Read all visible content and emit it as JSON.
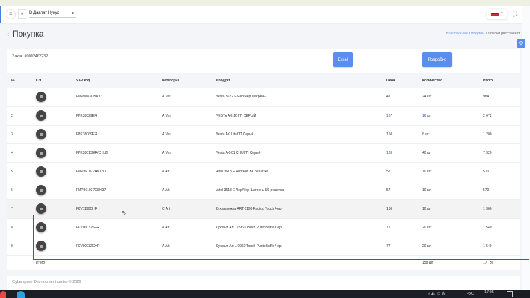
{
  "header": {
    "branch": "D Давлат Нукус"
  },
  "page": {
    "title": "Покупка",
    "breadcrumbs": [
      "приложение",
      "покупки",
      "sidebar.purchaseid"
    ]
  },
  "order": {
    "label": "Заказ: #0003463232",
    "excel": "Excel",
    "details": "Подробно"
  },
  "table": {
    "columns": [
      "№",
      "CH",
      "SAP код",
      "Категория",
      "Продукт",
      "Цена",
      "Количество",
      "Итого"
    ],
    "rows": [
      {
        "n": "1",
        "sap": "FMP0083CHR37",
        "cat": "A Ves",
        "product": "Vesta 3622 E Чер/Чер Шагрень",
        "price": "41",
        "qty": "24 шт",
        "total": "984"
      },
      {
        "n": "2",
        "sap": "FPK38029ER",
        "cat": "A Ves",
        "product": "VESTA AK-10 ГП СЕРЫЙ",
        "price": "167",
        "qty": "16 шт",
        "total": "2 672"
      },
      {
        "n": "3",
        "sap": "FPK38069ER",
        "cat": "A Ves",
        "product": "Vesta AK Lite ГП Серый",
        "price": "150",
        "qty": "8 шт",
        "total": "1 200"
      },
      {
        "n": "4",
        "sap": "FPK3801SER/CHUG",
        "cat": "A Ves",
        "product": "Vesta AK-01 CHU ГП Серый",
        "price": "183",
        "qty": "40 шт",
        "total": "7 320"
      },
      {
        "n": "5",
        "sap": "FMP361027ANT30",
        "cat": "A Art",
        "product": "Artel 3618 E Ант/Ант БК решетка",
        "price": "57",
        "qty": "10 шт",
        "total": "570"
      },
      {
        "n": "6",
        "sap": "FMP361027CSH37",
        "cat": "A Art",
        "product": "Artel 3618 E Чер/Чер Шагрень БК решетка",
        "price": "57",
        "qty": "10 шт",
        "total": "570"
      },
      {
        "n": "7",
        "sap": "FKV1190CHR",
        "cat": "C Art",
        "product": "Кух вытяжка ART-1190 Rapido Touch Чер",
        "price": "136",
        "qty": "10 шт",
        "total": "1 360"
      },
      {
        "n": "8",
        "sap": "FKV00032SER",
        "cat": "A Art",
        "product": "Кух выт Art L-0960 Touch PuntoBaffle Сер",
        "price": "77",
        "qty": "20 шт",
        "total": "1 540"
      },
      {
        "n": "9",
        "sap": "FKV00032CHR",
        "cat": "A Art",
        "product": "Кух выт Art L-0960 Touch PuntoBaffle Чер",
        "price": "77",
        "qty": "20 шт",
        "total": "1 540"
      }
    ],
    "total": {
      "label": "Итого",
      "qty": "158 шт",
      "sum": "17 756"
    }
  },
  "footer": "Cyberspace Development center © 2026",
  "taskbar": {
    "lang": "РУС",
    "time": "17:05"
  }
}
